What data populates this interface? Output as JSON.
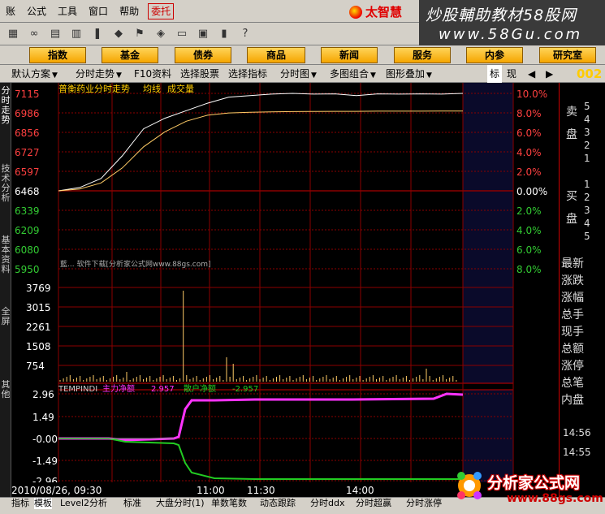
{
  "menu": {
    "items": [
      "账",
      "公式",
      "工具",
      "窗口",
      "帮助"
    ],
    "delegate": "委托",
    "brand": "太智慧"
  },
  "watermark": {
    "line1": "炒股輔助教材58股网",
    "line2": "www.58Gu.com"
  },
  "nav": {
    "items": [
      "指数",
      "基金",
      "债券",
      "商品",
      "新闻",
      "服务",
      "内参",
      "研究室"
    ]
  },
  "funcbar": {
    "items": [
      "默认方案",
      "分时走势",
      "F10资料",
      "选择股票",
      "选择指标",
      "分时图",
      "多图组合",
      "图形叠加"
    ],
    "mode": "标",
    "mode2": "现",
    "code": "002"
  },
  "sidebar": {
    "tabs": [
      "分时走势",
      "技术分析",
      "基本资料",
      "全屏",
      "其他"
    ]
  },
  "chart": {
    "title": "普衡药业分时走势",
    "legend_avg": "均线",
    "legend_vol": "成交量",
    "price_ticks": [
      "7115",
      "6986",
      "6856",
      "6727",
      "6597",
      "6468",
      "6339",
      "6209",
      "6080",
      "5950"
    ],
    "pct_ticks": [
      "10.0%",
      "8.0%",
      "6.0%",
      "4.0%",
      "2.0%",
      "0.00%",
      "2.0%",
      "4.0%",
      "6.0%",
      "8.0%"
    ],
    "vol_ticks": [
      "3769",
      "3015",
      "2261",
      "1508",
      "754"
    ],
    "ind_ticks": [
      "2.96",
      "1.49",
      "-0.00",
      "-1.49",
      "-2.96"
    ],
    "ind_name": "TEMPINDI",
    "ind_main": "主力净额",
    "ind_main_val": "2.957",
    "ind_retail": "散户净额",
    "ind_retail_val": "-2.957",
    "date": "2010/08/26, 09:30",
    "time_ticks": [
      "11:00",
      "11:30",
      "14:00"
    ],
    "overlay_text": "藍... 软件下载[分析家公式网www.88gs.com]"
  },
  "right": {
    "sell": "卖盘",
    "buy": "买盘",
    "sell_nums": [
      "5",
      "4",
      "3",
      "2",
      "1"
    ],
    "buy_nums": [
      "1",
      "2",
      "3",
      "4",
      "5"
    ],
    "items": [
      "最新",
      "涨跌",
      "涨幅",
      "总手",
      "现手",
      "总额",
      "涨停",
      "总笔",
      "内盘"
    ],
    "time": "14:56",
    "time2": "14:55"
  },
  "bottom": {
    "items": [
      "指标",
      "模板",
      "Level2分析",
      "标准",
      "大盘分时(1)",
      "单数笔数",
      "动态跟踪",
      "分时ddx",
      "分时超赢",
      "分时涨停"
    ]
  },
  "logo": {
    "name": "分析家公式网",
    "url": "www.88gs.com"
  },
  "chart_data": {
    "type": "line",
    "series": [
      {
        "name": "",
        "values": [
          6468,
          6490,
          6550,
          6700,
          6880,
          6950,
          7000,
          7050,
          7090,
          7100,
          7110,
          7115,
          7110,
          7112,
          7100,
          7112,
          7110,
          7112,
          7110,
          7115
        ]
      },
      {
        "name": "均线",
        "values": [
          6468,
          6480,
          6520,
          6620,
          6760,
          6860,
          6930,
          6970,
          6985,
          6990,
          6992,
          6994,
          6995,
          6996,
          6996,
          6997,
          6997,
          6997,
          6998,
          6998
        ]
      }
    ],
    "ylim": [
      5950,
      7115
    ]
  }
}
